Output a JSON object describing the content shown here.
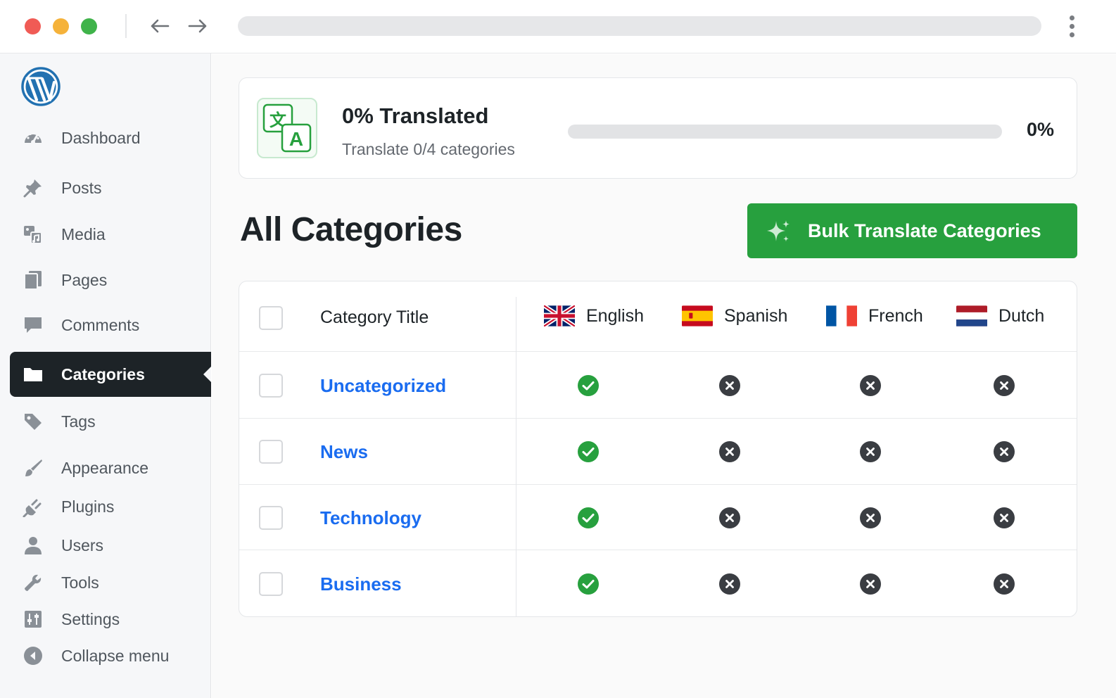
{
  "sidebar": {
    "logo_icon": "wordpress-logo",
    "items": [
      {
        "label": "Dashboard",
        "icon": "dashboard-icon"
      },
      {
        "label": "Posts",
        "icon": "pin-icon"
      },
      {
        "label": "Media",
        "icon": "media-icon"
      },
      {
        "label": "Pages",
        "icon": "pages-icon"
      },
      {
        "label": "Comments",
        "icon": "comment-icon"
      },
      {
        "label": "Categories",
        "icon": "folder-icon",
        "active": true
      },
      {
        "label": "Tags",
        "icon": "tag-icon"
      },
      {
        "label": "Appearance",
        "icon": "brush-icon"
      },
      {
        "label": "Plugins",
        "icon": "plug-icon"
      },
      {
        "label": "Users",
        "icon": "user-icon"
      },
      {
        "label": "Tools",
        "icon": "wrench-icon"
      },
      {
        "label": "Settings",
        "icon": "sliders-icon"
      },
      {
        "label": "Collapse menu",
        "icon": "collapse-icon"
      }
    ]
  },
  "progress": {
    "title": "0% Translated",
    "subtitle": "Translate 0/4 categories",
    "percent_label": "0%",
    "fraction": 0
  },
  "page_title": "All Categories",
  "bulk_button_label": "Bulk Translate Categories",
  "table": {
    "title_header": "Category Title",
    "languages": [
      {
        "name": "English",
        "flag": "uk-flag"
      },
      {
        "name": "Spanish",
        "flag": "spain-flag"
      },
      {
        "name": "French",
        "flag": "france-flag"
      },
      {
        "name": "Dutch",
        "flag": "netherlands-flag"
      }
    ],
    "rows": [
      {
        "title": "Uncategorized",
        "status": [
          "translated",
          "missing",
          "missing",
          "missing"
        ]
      },
      {
        "title": "News",
        "status": [
          "translated",
          "missing",
          "missing",
          "missing"
        ]
      },
      {
        "title": "Technology",
        "status": [
          "translated",
          "missing",
          "missing",
          "missing"
        ]
      },
      {
        "title": "Business",
        "status": [
          "translated",
          "missing",
          "missing",
          "missing"
        ]
      }
    ]
  },
  "colors": {
    "accent_green": "#27a03e",
    "link_blue": "#1a6cf0",
    "sidebar_active": "#1d2327",
    "missing_gray": "#3a3d42"
  }
}
